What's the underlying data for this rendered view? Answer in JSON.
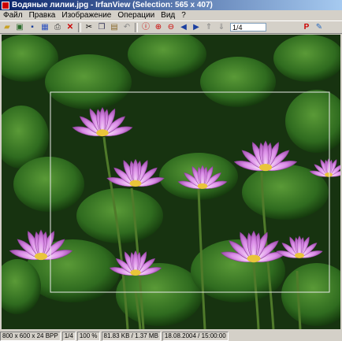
{
  "window": {
    "title": "Водяные лилии.jpg - IrfanView (Selection: 565 x 407)"
  },
  "menu": [
    "Файл",
    "Правка",
    "Изображение",
    "Операции",
    "Вид",
    "?"
  ],
  "toolbar": {
    "page_value": "1/4",
    "icons": [
      "open-folder-icon",
      "slideshow-icon",
      "save-icon",
      "thumbnails-icon",
      "print-icon",
      "delete-icon",
      "cut-icon",
      "copy-icon",
      "paste-icon",
      "undo-icon",
      "info-icon",
      "zoom-in-icon",
      "zoom-out-icon",
      "previous-icon",
      "next-icon",
      "first-page-icon",
      "last-page-icon",
      "pdf-icon",
      "paint-icon"
    ]
  },
  "status": {
    "dimensions": "800 x 600 x 24 BPP",
    "page": "1/4",
    "zoom": "100 %",
    "size": "81.83 KB / 1.37 MB",
    "datetime": "18.08.2004 / 15:00:00"
  },
  "colors": {
    "title_gradient_start": "#0a246a",
    "title_gradient_end": "#a6caf0",
    "petal": "#d98be6",
    "leaf": "#2f6b1f"
  }
}
